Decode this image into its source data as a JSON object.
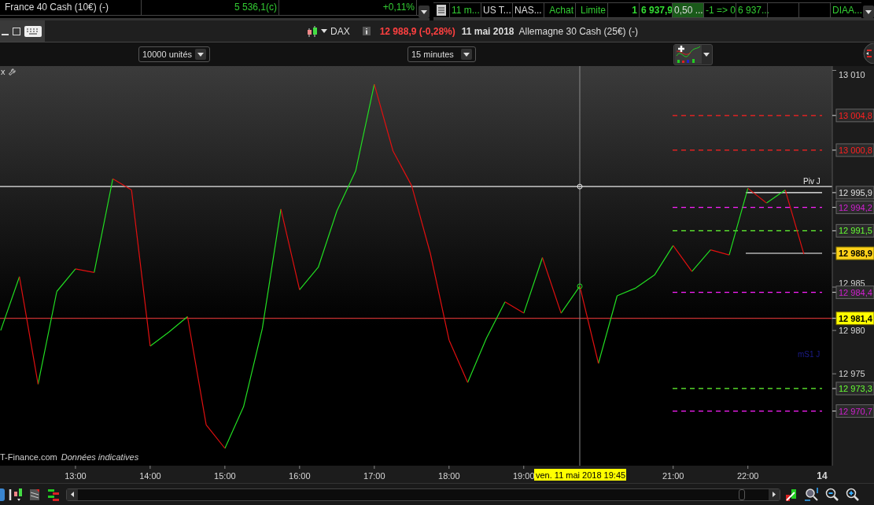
{
  "watchlist": {
    "rows": [
      {
        "name": "France 40 Cash (10€) (-)",
        "price": "5 536,1(c)",
        "change": "+0,11%"
      }
    ]
  },
  "orders": {
    "rows": [
      {
        "cells": [
          "11 m...",
          "US T...",
          "NAS...",
          "Achat",
          "Limite",
          "1",
          "6 937,9",
          "0,50 ...",
          "-1 => 0",
          "6 937...",
          "DIAA..."
        ]
      }
    ]
  },
  "title_bar": {
    "symbol": "DAX",
    "quote": "12 988,9 (-0,28%)",
    "date": "11 mai 2018",
    "name": "Allemagne 30 Cash (25€) (-)"
  },
  "toolbar": {
    "quantity": "10000 unités",
    "period": "15 minutes"
  },
  "chart_header": {
    "close": "x"
  },
  "chart_footer": {
    "source": "T-Finance.com",
    "note": "Données indicatives"
  },
  "time_axis_day": "14",
  "price_tags": [
    {
      "kind": "tag",
      "color": "#ff2020",
      "dashed": true,
      "full_width": false
    },
    {
      "kind": "tag",
      "color": "#ff2020",
      "dashed": true,
      "full_width": false
    },
    {
      "kind": "tag",
      "color": "#e0e0e0",
      "dashed": false,
      "full_width": false
    },
    {
      "kind": "tag",
      "color": "#d020d0",
      "dashed": true,
      "full_width": false
    },
    {
      "kind": "tag",
      "color": "#66ff33",
      "dashed": true,
      "full_width": false
    },
    {
      "kind": "highlight",
      "color": "#ffd21a",
      "dashed": false,
      "full_width": false
    },
    {
      "kind": "tag",
      "color": "#d020d0",
      "dashed": true,
      "full_width": false
    },
    {
      "kind": "highlight",
      "color": "#ffff00",
      "dashed": false,
      "full_width": true
    },
    {
      "kind": "tag",
      "color": "#66ff33",
      "dashed": true,
      "full_width": false
    },
    {
      "kind": "tag",
      "color": "#d020d0",
      "dashed": true,
      "full_width": false
    }
  ],
  "chart": {
    "chart_data": {
      "type": "line",
      "x": [
        12,
        12.25,
        12.5,
        12.75,
        13,
        13.25,
        13.5,
        13.75,
        14,
        14.25,
        14.5,
        14.75,
        15,
        15.25,
        15.5,
        15.75,
        16,
        16.25,
        16.5,
        16.75,
        17,
        17.25,
        17.5,
        17.75,
        18,
        18.25,
        18.5,
        18.75,
        19,
        19.25,
        19.5,
        19.75,
        20,
        20.25,
        20.5,
        20.75,
        21,
        21.25,
        21.5,
        21.75,
        22,
        22.25,
        22.5,
        22.75
      ],
      "series": [
        {
          "color": "#22dd22",
          "values": [
            12980.0,
            12986.2,
            12973.8,
            12984.5,
            12987.1,
            12986.7,
            12997.5,
            null,
            12978.2,
            12979.8,
            12981.6,
            null,
            12966.4,
            12971.2,
            12980.2,
            12994.0,
            12984.7,
            12987.3,
            12993.8,
            12998.4,
            13008.4,
            null,
            null,
            null,
            null,
            12974.0,
            12979.1,
            12983.3,
            12982.0,
            12988.4,
            12982.0,
            12985.1,
            12976.2,
            12984.0,
            12984.9,
            12986.4,
            12989.8,
            12986.8,
            12989.3,
            12988.7,
            12996.4,
            12994.7,
            12996.2,
            null
          ]
        },
        {
          "color": "#e01010",
          "values": [
            null,
            12986.2,
            12973.8,
            null,
            12987.1,
            12986.7,
            12997.5,
            12996.2,
            12978.2,
            null,
            12981.6,
            12969.1,
            12966.4,
            null,
            null,
            12994.0,
            12984.7,
            null,
            null,
            null,
            13008.4,
            13000.7,
            12996.7,
            12988.9,
            12978.9,
            12974.0,
            null,
            12983.3,
            12982.0,
            12988.4,
            12982.0,
            12985.1,
            12976.2,
            null,
            null,
            null,
            12989.8,
            12986.8,
            12989.3,
            12988.7,
            12996.4,
            12994.7,
            12996.2,
            12988.8
          ]
        }
      ],
      "xlim": [
        11.99,
        23.13
      ],
      "ylim": [
        12964.4,
        13010.5
      ],
      "xticks": [
        {
          "value": 13,
          "label": "13:00"
        },
        {
          "value": 14,
          "label": "14:00"
        },
        {
          "value": 15,
          "label": "15:00"
        },
        {
          "value": 16,
          "label": "16:00"
        },
        {
          "value": 17,
          "label": "17:00"
        },
        {
          "value": 18,
          "label": "18:00"
        },
        {
          "value": 19,
          "label": "19:00"
        },
        {
          "value": 21,
          "label": "21:00"
        },
        {
          "value": 22,
          "label": "22:00"
        }
      ],
      "yticks": [
        {
          "value": 13010,
          "label": "13 010"
        },
        {
          "value": 12985,
          "label": "12 985"
        },
        {
          "value": 12980,
          "label": "12 980"
        },
        {
          "value": 12975,
          "label": "12 975"
        }
      ],
      "ref_lines": [
        {
          "axis": "y",
          "value": 13004.8,
          "label": "13 004,8",
          "color": "#ff2020"
        },
        {
          "axis": "y",
          "value": 13000.8,
          "label": "13 000,8",
          "color": "#ff2020"
        },
        {
          "axis": "y",
          "value": 12995.9,
          "label": "12 995,9",
          "color": "#ffffff"
        },
        {
          "axis": "y",
          "value": 12994.2,
          "label": "12 994,2",
          "color": "#ff20ff"
        },
        {
          "axis": "y",
          "value": 12991.5,
          "label": "12 991,5",
          "color": "#66ff33"
        },
        {
          "axis": "y",
          "value": 12988.9,
          "label": "12 988,9",
          "color": "#ffffff"
        },
        {
          "axis": "y",
          "value": 12984.4,
          "label": "12 984,4",
          "color": "#ff20ff"
        },
        {
          "axis": "y",
          "value": 12981.4,
          "label": "12 981,4",
          "color": "#c83232"
        },
        {
          "axis": "y",
          "value": 12973.3,
          "label": "12 973,3",
          "color": "#66ff33"
        },
        {
          "axis": "y",
          "value": 12970.7,
          "label": "12 970,7",
          "color": "#ff20ff"
        },
        {
          "axis": "x",
          "value": 19.75,
          "color": "#8a8a8a"
        },
        {
          "axis": "y",
          "value": 12996.6,
          "color": "#e8e8e8"
        }
      ],
      "annotations": [
        "ven. 11 mai 2018 19:45",
        "Piv J",
        "mS1 J"
      ]
    }
  }
}
